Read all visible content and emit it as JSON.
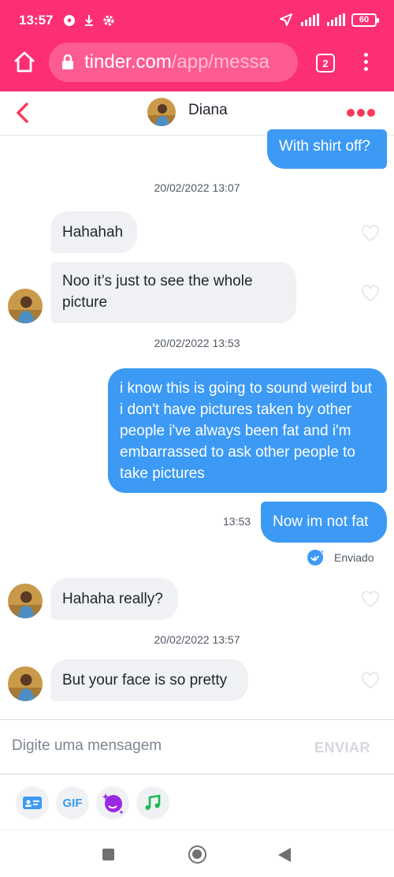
{
  "status_bar": {
    "time": "13:57",
    "battery": "60",
    "network": "4G+"
  },
  "browser": {
    "url_host": "tinder.com",
    "url_path": "/app/messa",
    "tab_count": "2"
  },
  "chat": {
    "contact_name": "Diana"
  },
  "messages": [
    {
      "dir": "out",
      "text": "With shirt off?"
    },
    {
      "type": "date",
      "text": "20/02/2022 13:07"
    },
    {
      "dir": "in",
      "text": "Hahahah"
    },
    {
      "dir": "in",
      "text": "Noo it’s just to see the whole picture"
    },
    {
      "type": "date",
      "text": "20/02/2022 13:53"
    },
    {
      "dir": "out",
      "text": "i know this is going to sound weird but i don't have pictures taken by other people i've always been fat and i'm embarrassed to ask other people to take pictures"
    },
    {
      "dir": "out",
      "text": "Now im not fat",
      "time": "13:53"
    },
    {
      "type": "status",
      "text": "Enviado"
    },
    {
      "dir": "in",
      "text": "Hahaha really?"
    },
    {
      "type": "date",
      "text": "20/02/2022 13:57"
    },
    {
      "dir": "in",
      "text": "But your face is so pretty"
    }
  ],
  "composer": {
    "placeholder": "Digite uma mensagem",
    "send_label": "ENVIAR"
  },
  "actions": {
    "gif_label": "GIF"
  },
  "colors": {
    "brand": "#fd2f73",
    "outgoing": "#3c9af4",
    "incoming": "#eff1f4",
    "accent_red": "#fd3a5a"
  }
}
